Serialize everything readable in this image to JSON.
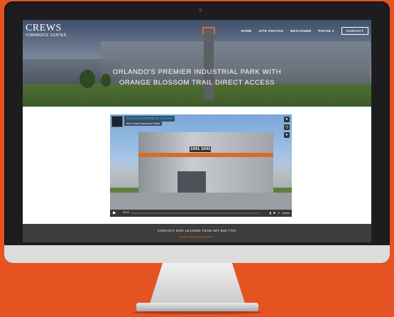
{
  "site": {
    "logo_name": "CREWS",
    "logo_sub": "COMMERCE CENTER"
  },
  "nav": {
    "items": [
      "HOME",
      "SITE PHOTOS",
      "BROCHURE",
      "PHASE 2"
    ],
    "contact_label": "CONTACT"
  },
  "hero": {
    "headline_line1": "ORLANDO'S PREMIER INDUSTRIAL PARK WITH",
    "headline_line2": "ORANGE BLOSSOM TRAIL DIRECT ACCESS"
  },
  "video": {
    "title": "Crews Commerce Center",
    "subtitle": "from Crews Commerce Center",
    "time": "02:10",
    "sign_text": "1041 1041",
    "brand": "vimeo"
  },
  "footer": {
    "contact_text": "CONTACT OUR LEASING TEAM 407-540-7727",
    "map_link": "MAP TO PROPERTY"
  },
  "colors": {
    "background": "#e65322",
    "accent": "#e8602a",
    "footer": "#3d3d3d",
    "video_title": "#1fa7e2"
  },
  "icons": [
    "heart-icon",
    "clock-icon",
    "share-icon",
    "play-icon",
    "volume-icon",
    "settings-icon",
    "fullscreen-icon"
  ]
}
